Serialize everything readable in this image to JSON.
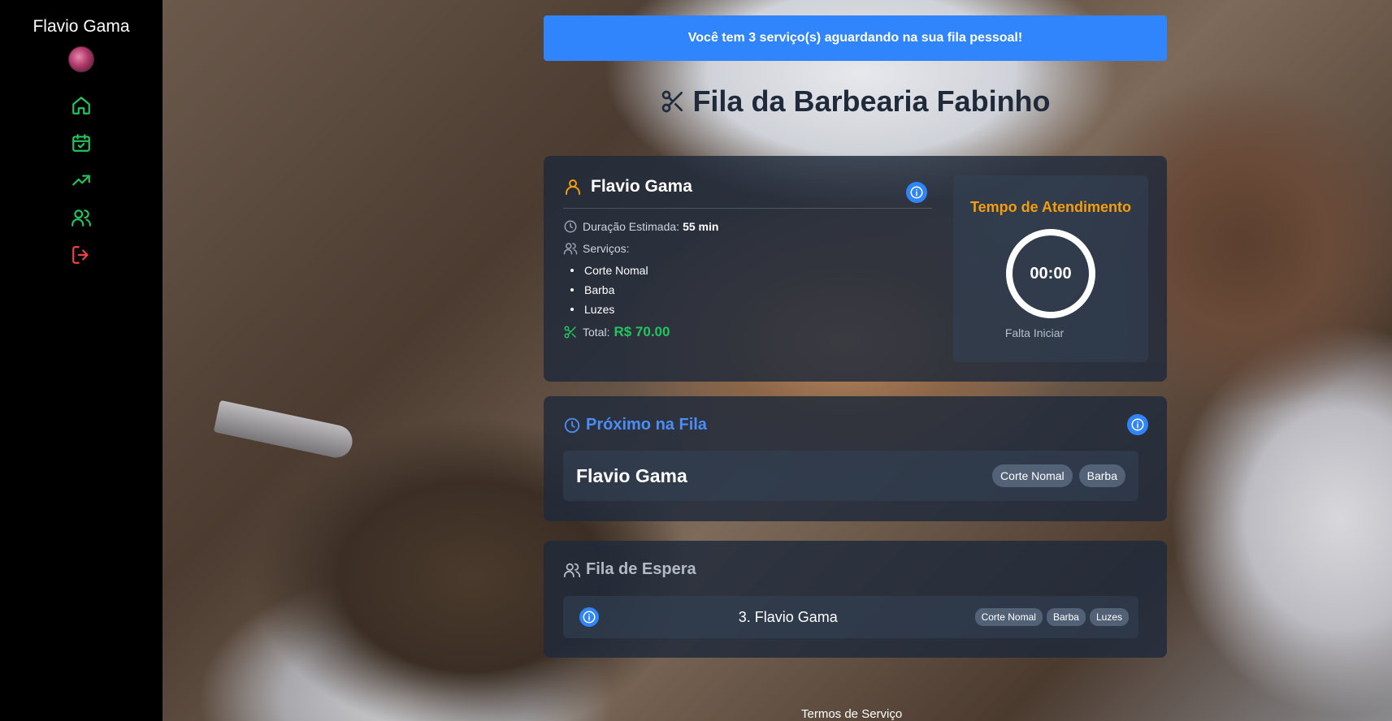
{
  "sidebar": {
    "user_name": "Flavio Gama",
    "nav": [
      {
        "icon": "home-icon",
        "color": "#22c55e"
      },
      {
        "icon": "calendar-check-icon",
        "color": "#22c55e"
      },
      {
        "icon": "trending-up-icon",
        "color": "#22c55e"
      },
      {
        "icon": "users-icon",
        "color": "#22c55e"
      },
      {
        "icon": "logout-icon",
        "color": "#ef4444"
      }
    ]
  },
  "banner": {
    "text": "Você tem 3 serviço(s) aguardando na sua fila pessoal!",
    "color": "#3185fc"
  },
  "page_title": "Fila da Barbearia Fabinho",
  "current": {
    "name": "Flavio Gama",
    "duration_label": "Duração Estimada:",
    "duration_value": "55 min",
    "services_label": "Serviços:",
    "services": [
      "Corte Nomal",
      "Barba",
      "Luzes"
    ],
    "total_label": "Total:",
    "total_value": "R$ 70.00",
    "timer_title": "Tempo de Atendimento",
    "timer_value": "00:00",
    "timer_status": "Falta Iniciar"
  },
  "next": {
    "title": "Próximo na Fila",
    "name": "Flavio Gama",
    "tags": [
      "Corte Nomal",
      "Barba"
    ]
  },
  "waiting": {
    "title": "Fila de Espera",
    "items": [
      {
        "label": "3. Flavio Gama",
        "tags": [
          "Corte Nomal",
          "Barba",
          "Luzes"
        ]
      }
    ]
  },
  "footer": {
    "link": "Termos de Serviço"
  }
}
